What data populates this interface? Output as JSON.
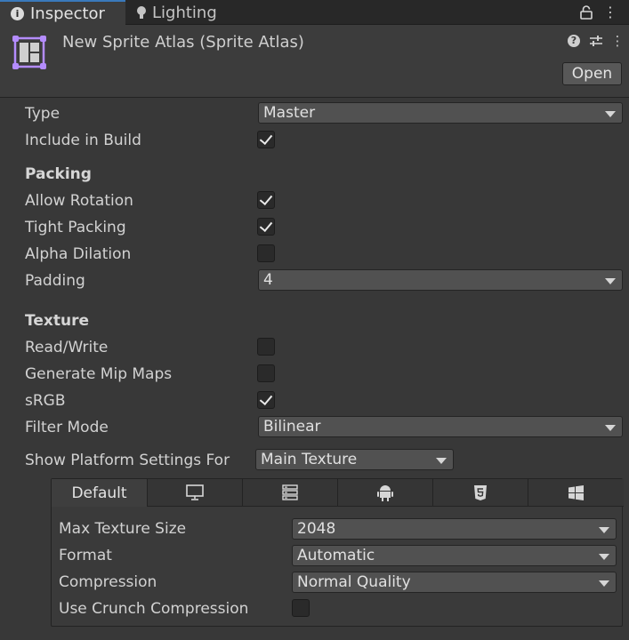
{
  "tabs": [
    {
      "label": "Inspector",
      "icon": "info-icon",
      "active": true
    },
    {
      "label": "Lighting",
      "icon": "lightbulb-icon",
      "active": false
    }
  ],
  "header": {
    "title": "New Sprite Atlas (Sprite Atlas)",
    "open_label": "Open",
    "icon_color": "#b48cff"
  },
  "fields": {
    "type": {
      "label": "Type",
      "value": "Master"
    },
    "include_in_build": {
      "label": "Include in Build",
      "checked": true
    }
  },
  "packing": {
    "title": "Packing",
    "allow_rotation": {
      "label": "Allow Rotation",
      "checked": true
    },
    "tight_packing": {
      "label": "Tight Packing",
      "checked": true
    },
    "alpha_dilation": {
      "label": "Alpha Dilation",
      "checked": false
    },
    "padding": {
      "label": "Padding",
      "value": "4"
    }
  },
  "texture": {
    "title": "Texture",
    "read_write": {
      "label": "Read/Write",
      "checked": false
    },
    "generate_mip_maps": {
      "label": "Generate Mip Maps",
      "checked": false
    },
    "srgb": {
      "label": "sRGB",
      "checked": true
    },
    "filter_mode": {
      "label": "Filter Mode",
      "value": "Bilinear"
    }
  },
  "platform": {
    "label": "Show Platform Settings For",
    "value": "Main Texture",
    "tabs": [
      {
        "label": "Default",
        "icon": ""
      },
      {
        "label": "",
        "icon": "monitor-icon"
      },
      {
        "label": "",
        "icon": "server-icon"
      },
      {
        "label": "",
        "icon": "android-icon"
      },
      {
        "label": "",
        "icon": "html5-icon"
      },
      {
        "label": "",
        "icon": "windows-icon"
      }
    ],
    "max_texture_size": {
      "label": "Max Texture Size",
      "value": "2048"
    },
    "format": {
      "label": "Format",
      "value": "Automatic"
    },
    "compression": {
      "label": "Compression",
      "value": "Normal Quality"
    },
    "use_crunch": {
      "label": "Use Crunch Compression",
      "checked": false
    }
  }
}
